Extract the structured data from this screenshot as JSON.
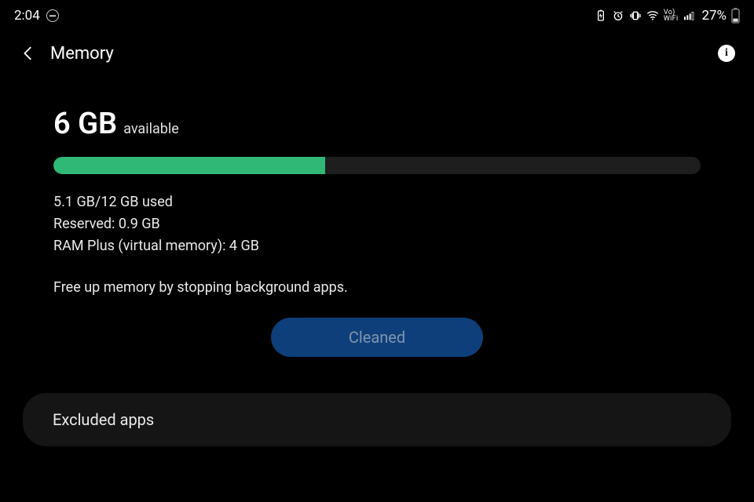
{
  "status": {
    "time": "2:04",
    "battery_percent": "27%",
    "wifi_label_top": "Vo)",
    "wifi_label_bottom": "WiFi"
  },
  "header": {
    "title": "Memory",
    "info_glyph": "i"
  },
  "memory": {
    "available_value": "6 GB",
    "available_label": "available",
    "usage_percent": 42,
    "used_line": "5.1 GB/12 GB used",
    "reserved_line": "Reserved: 0.9 GB",
    "ramplus_line": "RAM Plus (virtual memory): 4 GB",
    "hint": "Free up memory by stopping background apps.",
    "clean_button": "Cleaned"
  },
  "excluded": {
    "label": "Excluded apps"
  }
}
